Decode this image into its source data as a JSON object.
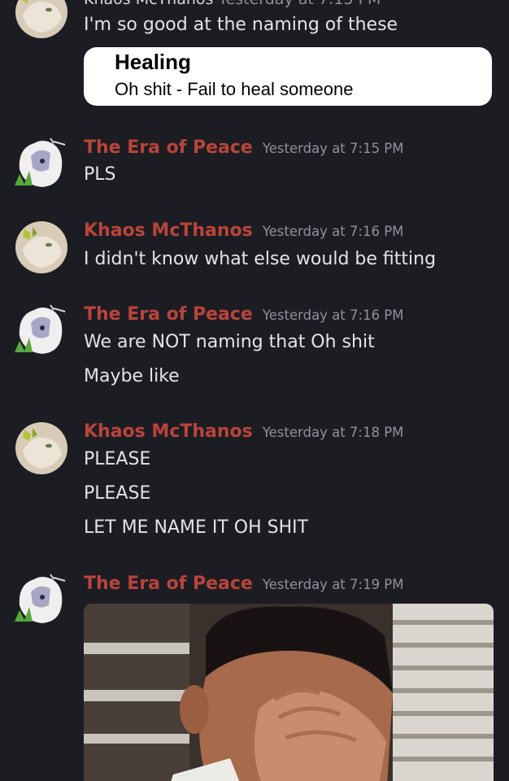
{
  "header": {
    "partial_user": "Khaos McThanos",
    "partial_time": "Yesterday at 7:15 PM"
  },
  "colors": {
    "background": "#1c1d23",
    "username": "#b9443a",
    "timestamp": "#8f929b",
    "text": "#e3e4e8"
  },
  "messages": [
    {
      "text": "I'm so good at the naming of these"
    },
    {
      "embed": {
        "title": "Healing",
        "body": "Oh shit  - Fail to heal someone"
      }
    },
    {
      "author": "The Era of Peace",
      "time": "Yesterday at 7:15 PM",
      "avatar_icon": "cat-avatar-white",
      "lines": [
        "PLS"
      ]
    },
    {
      "author": "Khaos McThanos",
      "time": "Yesterday at 7:16 PM",
      "avatar_icon": "cat-avatar-butterfly",
      "lines": [
        "I didn't know what else would be fitting"
      ]
    },
    {
      "author": "The Era of Peace",
      "time": "Yesterday at 7:16 PM",
      "avatar_icon": "cat-avatar-white",
      "lines": [
        "We are NOT naming that Oh shit",
        "Maybe like"
      ]
    },
    {
      "author": "Khaos McThanos",
      "time": "Yesterday at 7:18 PM",
      "avatar_icon": "cat-avatar-butterfly",
      "lines": [
        "PLEASE",
        "PLEASE",
        "LET ME NAME IT OH SHIT"
      ]
    },
    {
      "author": "The Era of Peace",
      "time": "Yesterday at 7:19 PM",
      "avatar_icon": "cat-avatar-white",
      "attachment": "facepalm-gif"
    }
  ]
}
